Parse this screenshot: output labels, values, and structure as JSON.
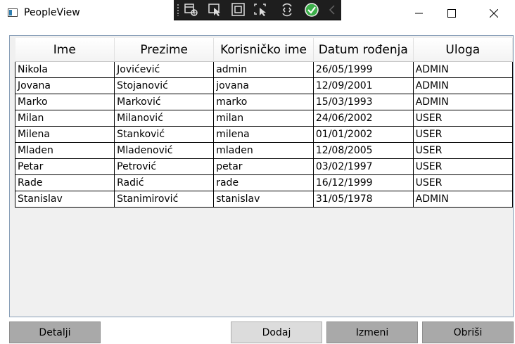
{
  "window": {
    "title": "PeopleView",
    "minimize_glyph": "—",
    "close_glyph": "✕"
  },
  "devtools": {
    "icons": [
      "live-visual-tree-icon",
      "select-element-icon",
      "display-layout-adorners-icon",
      "track-focus-icon",
      "hot-reload-icon",
      "binding-ok-icon",
      "collapse-chevron-icon"
    ]
  },
  "grid": {
    "columns": [
      "Ime",
      "Prezime",
      "Korisničko ime",
      "Datum rođenja",
      "Uloga"
    ],
    "rows": [
      [
        "Nikola",
        "Jovićević",
        "admin",
        "26/05/1999",
        "ADMIN"
      ],
      [
        "Jovana",
        "Stojanović",
        "jovana",
        "12/09/2001",
        "ADMIN"
      ],
      [
        "Marko",
        "Marković",
        "marko",
        "15/03/1993",
        "ADMIN"
      ],
      [
        "Milan",
        "Milanović",
        "milan",
        "24/06/2002",
        "USER"
      ],
      [
        "Milena",
        "Stanković",
        "milena",
        "01/01/2002",
        "USER"
      ],
      [
        "Mladen",
        "Mladenović",
        "mladen",
        "12/08/2005",
        "USER"
      ],
      [
        "Petar",
        "Petrović",
        "petar",
        "03/02/1997",
        "USER"
      ],
      [
        "Rade",
        "Radić",
        "rade",
        "16/12/1999",
        "USER"
      ],
      [
        "Stanislav",
        "Stanimirović",
        "stanislav",
        "31/05/1978",
        "ADMIN"
      ]
    ]
  },
  "buttons": {
    "details": "Detalji",
    "add": "Dodaj",
    "edit": "Izmeni",
    "delete": "Obriši"
  },
  "colors": {
    "disabled_button": "#a9a9a9",
    "enabled_button": "#dcdcdc",
    "devbar_bg": "#1e1e1e",
    "grid_border": "#8aa0b8",
    "hot_reload_ok": "#3cb04a"
  }
}
